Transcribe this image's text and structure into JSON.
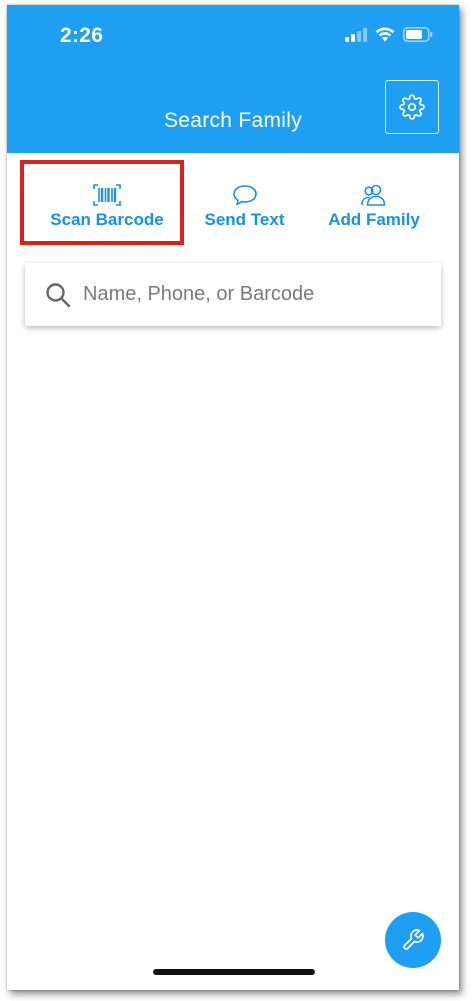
{
  "status_bar": {
    "time": "2:26"
  },
  "header": {
    "title": "Search Family",
    "settings_icon": "gear-icon",
    "background_color": "#1e9ff2"
  },
  "actions": [
    {
      "label": "Scan Barcode",
      "icon": "barcode-icon"
    },
    {
      "label": "Send Text",
      "icon": "chat-bubble-icon"
    },
    {
      "label": "Add Family",
      "icon": "users-icon"
    }
  ],
  "highlight_color": "#d8231a",
  "accent_color": "#1a92dc",
  "search": {
    "placeholder": "Name, Phone, or Barcode",
    "value": ""
  },
  "fab": {
    "icon": "wrench-icon"
  }
}
